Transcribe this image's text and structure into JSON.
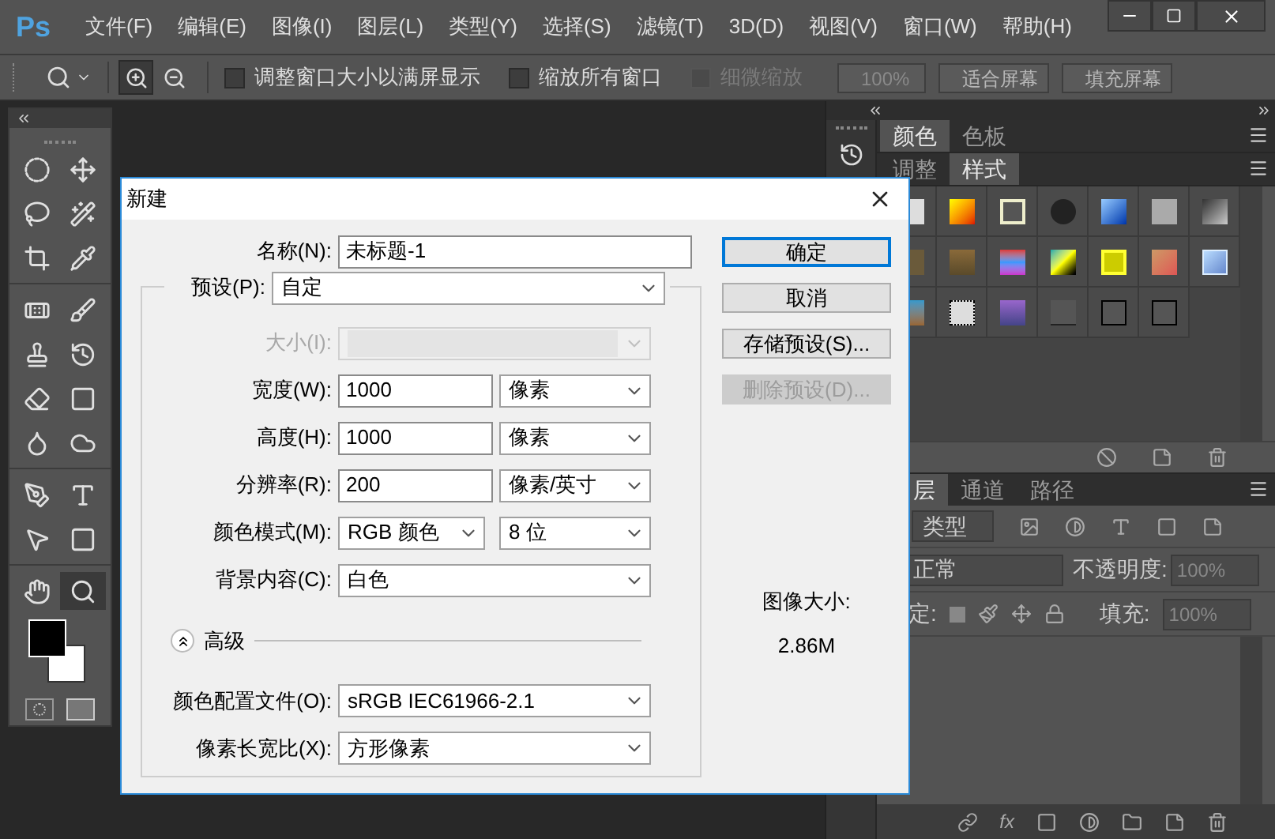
{
  "app": {
    "logo": "Ps"
  },
  "menu": [
    {
      "label": "文件(F)"
    },
    {
      "label": "编辑(E)"
    },
    {
      "label": "图像(I)"
    },
    {
      "label": "图层(L)"
    },
    {
      "label": "类型(Y)"
    },
    {
      "label": "选择(S)"
    },
    {
      "label": "滤镜(T)"
    },
    {
      "label": "3D(D)"
    },
    {
      "label": "视图(V)"
    },
    {
      "label": "窗口(W)"
    },
    {
      "label": "帮助(H)"
    }
  ],
  "options_bar": {
    "zoom_buttons": [
      {
        "kind": "zoom-in",
        "selected": true
      },
      {
        "kind": "zoom-out",
        "selected": false
      }
    ],
    "checkboxes": [
      {
        "label": "调整窗口大小以满屏显示",
        "checked": false,
        "disabled": false
      },
      {
        "label": "缩放所有窗口",
        "checked": false,
        "disabled": false
      },
      {
        "label": "细微缩放",
        "checked": false,
        "disabled": true
      }
    ],
    "buttons": [
      {
        "label": "100%",
        "disabled": true
      },
      {
        "label": "适合屏幕",
        "disabled": false
      },
      {
        "label": "填充屏幕",
        "disabled": false
      }
    ]
  },
  "tool_groups": [
    [
      {
        "kind": "marquee",
        "selected": false
      },
      {
        "kind": "move",
        "selected": false
      },
      {
        "kind": "lasso",
        "selected": false
      },
      {
        "kind": "wand",
        "selected": false
      },
      {
        "kind": "crop",
        "selected": false
      },
      {
        "kind": "eyedropper",
        "selected": false
      }
    ],
    [
      {
        "kind": "bandage",
        "selected": false
      },
      {
        "kind": "brush",
        "selected": false
      },
      {
        "kind": "stamp",
        "selected": false
      },
      {
        "kind": "history",
        "selected": false
      },
      {
        "kind": "eraser",
        "selected": false
      },
      {
        "kind": "gradient",
        "selected": false
      },
      {
        "kind": "drop",
        "selected": false
      },
      {
        "kind": "sponge",
        "selected": false
      }
    ],
    [
      {
        "kind": "pen",
        "selected": false
      },
      {
        "kind": "type",
        "selected": false
      },
      {
        "kind": "pointer",
        "selected": false
      },
      {
        "kind": "rectangle",
        "selected": false
      }
    ],
    [
      {
        "kind": "hand",
        "selected": false
      },
      {
        "kind": "zoom",
        "selected": true
      }
    ]
  ],
  "panels": [
    {
      "tabs": [
        {
          "label": "颜色",
          "selected": true
        },
        {
          "label": "色板",
          "selected": false
        }
      ]
    },
    {
      "tabs": [
        {
          "label": "调整",
          "selected": false
        },
        {
          "label": "样式",
          "selected": true
        }
      ]
    }
  ],
  "layers": {
    "tabs": [
      {
        "label": "层",
        "selected": true
      },
      {
        "label": "通道",
        "selected": false
      },
      {
        "label": "路径",
        "selected": false
      }
    ],
    "filter": "类型",
    "blend_mode": "正常",
    "opacity": {
      "label": "不透明度:",
      "value": "100%",
      "disabled": true
    },
    "lock_label": "定:",
    "fill": {
      "label": "填充:",
      "value": "100%",
      "disabled": true
    },
    "fx_label": "fx"
  },
  "dialog": {
    "title": "新建",
    "name": {
      "label": "名称(N):",
      "value": "未标题-1"
    },
    "preset": {
      "label": "预设(P):",
      "value": "自定"
    },
    "rows": [
      {
        "kind": "select",
        "label": "大小(I):",
        "disabled": true
      },
      {
        "kind": "number_unit",
        "label": "宽度(W):",
        "value": "1000",
        "unit": "像素",
        "disabled": false
      },
      {
        "kind": "number_unit",
        "label": "高度(H):",
        "value": "1000",
        "unit": "像素",
        "disabled": false
      },
      {
        "kind": "number_unit",
        "label": "分辨率(R):",
        "value": "200",
        "unit": "像素/英寸",
        "disabled": false
      },
      {
        "kind": "two_selects",
        "label": "颜色模式(M):",
        "value": "RGB 颜色",
        "unit": "8 位",
        "disabled": false
      },
      {
        "kind": "select",
        "label": "背景内容(C):",
        "value": "白色",
        "disabled": false
      }
    ],
    "advanced": {
      "label": "高级",
      "expanded": true
    },
    "advanced_rows": [
      {
        "label": "颜色配置文件(O):",
        "value": "sRGB IEC61966-2.1"
      },
      {
        "label": "像素长宽比(X):",
        "value": "方形像素"
      }
    ],
    "buttons": [
      {
        "label": "确定",
        "default": true,
        "disabled": false
      },
      {
        "label": "取消",
        "default": false,
        "disabled": false
      },
      {
        "label": "存储预设(S)...",
        "default": false,
        "disabled": false
      },
      {
        "label": "删除预设(D)...",
        "default": false,
        "disabled": true
      }
    ],
    "image_size": {
      "label": "图像大小:",
      "value": "2.86M"
    }
  }
}
